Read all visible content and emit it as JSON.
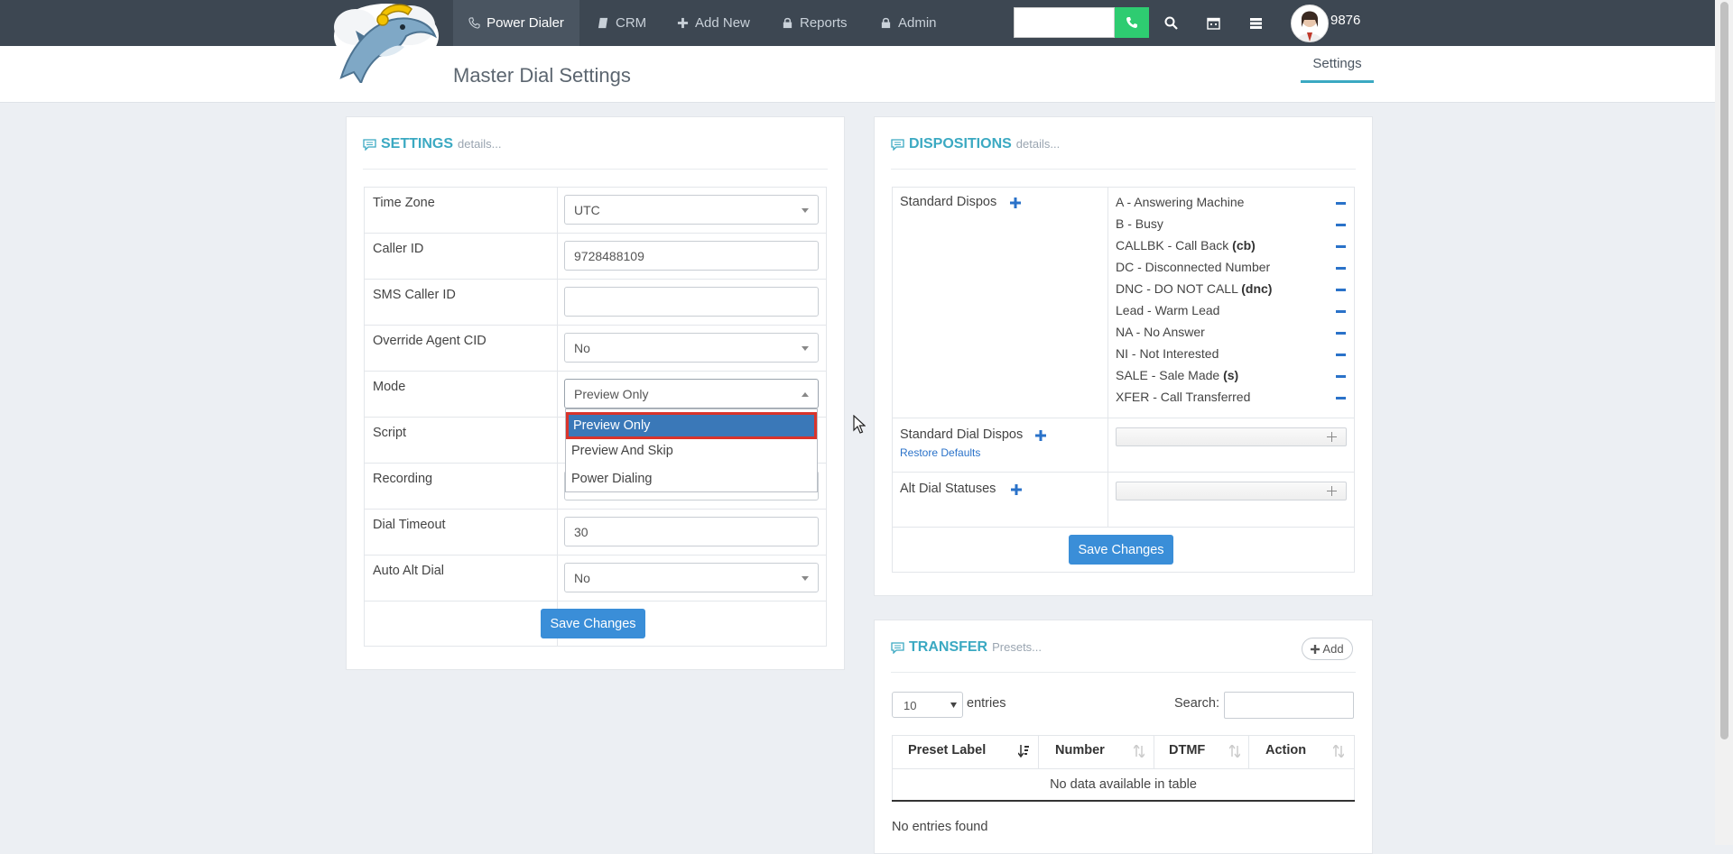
{
  "nav": {
    "items": [
      {
        "label": "Power Dialer",
        "icon": "phone-icon"
      },
      {
        "label": "CRM",
        "icon": "book-icon"
      },
      {
        "label": "Add New",
        "icon": "plus-icon"
      },
      {
        "label": "Reports",
        "icon": "lock-icon"
      },
      {
        "label": "Admin",
        "icon": "lock-icon"
      }
    ],
    "search_value": "",
    "user_number": "9876"
  },
  "header": {
    "title": "Master Dial Settings",
    "tab": "Settings"
  },
  "settings": {
    "title": "SETTINGS",
    "subtitle": "details...",
    "fields": {
      "timezone": {
        "label": "Time Zone",
        "value": "UTC"
      },
      "callerid": {
        "label": "Caller ID",
        "value": "9728488109"
      },
      "smscallerid": {
        "label": "SMS Caller ID",
        "value": ""
      },
      "override": {
        "label": "Override Agent CID",
        "value": "No"
      },
      "mode": {
        "label": "Mode",
        "value": "Preview Only"
      },
      "script": {
        "label": "Script"
      },
      "recording": {
        "label": "Recording"
      },
      "timeout": {
        "label": "Dial Timeout",
        "value": "30"
      },
      "autoalt": {
        "label": "Auto Alt Dial",
        "value": "No"
      }
    },
    "mode_options": [
      "Preview Only",
      "Preview And Skip",
      "Power Dialing"
    ],
    "save_label": "Save Changes"
  },
  "dispositions": {
    "title": "DISPOSITIONS",
    "subtitle": "details...",
    "standard_label": "Standard Dispos",
    "standard": [
      {
        "text": "A - Answering Machine",
        "code": ""
      },
      {
        "text": "B - Busy",
        "code": ""
      },
      {
        "text": "CALLBK - Call Back",
        "code": "(cb)"
      },
      {
        "text": "DC - Disconnected Number",
        "code": ""
      },
      {
        "text": "DNC - DO NOT CALL",
        "code": "(dnc)"
      },
      {
        "text": "Lead - Warm Lead",
        "code": ""
      },
      {
        "text": "NA - No Answer",
        "code": ""
      },
      {
        "text": "NI - Not Interested",
        "code": ""
      },
      {
        "text": "SALE - Sale Made",
        "code": "(s)"
      },
      {
        "text": "XFER - Call Transferred",
        "code": ""
      }
    ],
    "dial_label": "Standard Dial Dispos",
    "restore_label": "Restore Defaults",
    "alt_label": "Alt Dial Statuses",
    "save_label": "Save Changes"
  },
  "transfer": {
    "title": "TRANSFER",
    "subtitle": "Presets...",
    "add_label": "Add",
    "page_size": "10",
    "entries_label": "entries",
    "search_label": "Search:",
    "search_value": "",
    "columns": [
      "Preset Label",
      "Number",
      "DTMF",
      "Action"
    ],
    "empty_message": "No data available in table",
    "footer": "No entries found"
  }
}
